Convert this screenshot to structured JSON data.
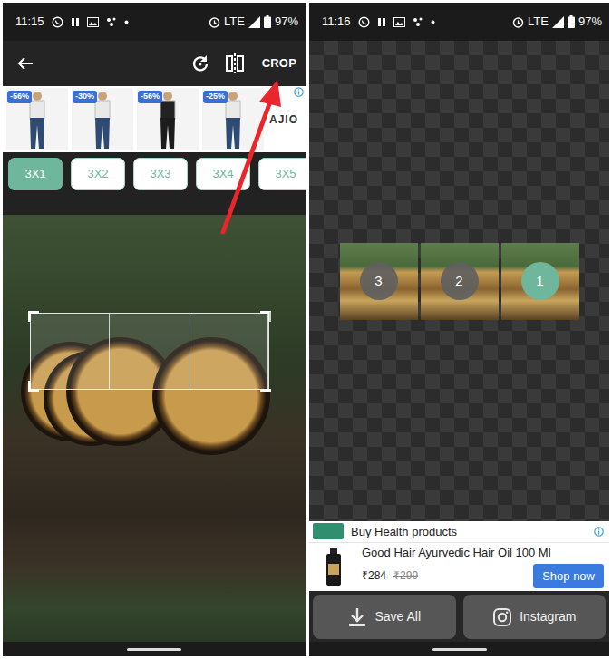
{
  "editor_screen": {
    "status_bar": {
      "time": "11:15",
      "network": "LTE",
      "battery": "97%"
    },
    "toolbar": {
      "action": "CROP"
    },
    "ad": {
      "items": [
        {
          "tag": "-56%"
        },
        {
          "tag": "-30%"
        },
        {
          "tag": "-56%"
        },
        {
          "tag": "-25%"
        }
      ],
      "brand": "AJIO"
    },
    "grid_options": [
      {
        "label": "3X1",
        "selected": true
      },
      {
        "label": "3X2",
        "selected": false
      },
      {
        "label": "3X3",
        "selected": false
      },
      {
        "label": "3X4",
        "selected": false
      },
      {
        "label": "3X5",
        "selected": false
      }
    ]
  },
  "preview_screen": {
    "status_bar": {
      "time": "11:16",
      "network": "LTE",
      "battery": "97%"
    },
    "tiles": [
      {
        "label": "3",
        "selected": false
      },
      {
        "label": "2",
        "selected": false
      },
      {
        "label": "1",
        "selected": true
      }
    ],
    "ad": {
      "title": "Buy Health products",
      "product": "Good Hair Ayurvedic Hair Oil 100 Ml",
      "price": "₹284",
      "old_price": "₹299",
      "cta": "Shop now"
    },
    "buttons": [
      {
        "label": "Save All",
        "kind": "download"
      },
      {
        "label": "Instagram",
        "kind": "instagram"
      }
    ]
  }
}
